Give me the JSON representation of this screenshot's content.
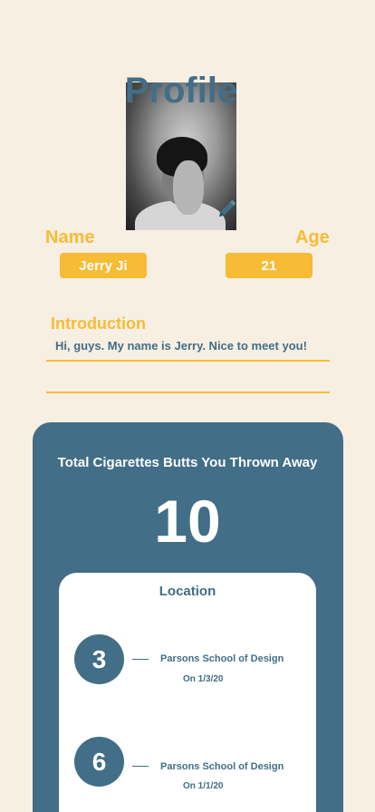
{
  "header": {
    "title": "Profile"
  },
  "profile": {
    "name_label": "Name",
    "age_label": "Age",
    "name_value": "Jerry Ji",
    "age_value": "21",
    "intro_label": "Introduction",
    "intro_text": "Hi, guys. My name is Jerry. Nice to meet you!"
  },
  "stats": {
    "title": "Total Cigarettes Butts You Thrown Away",
    "count": "10"
  },
  "locations": {
    "title": "Location",
    "items": [
      {
        "count": "3",
        "place": "Parsons School of Design",
        "date": "On 1/3/20"
      },
      {
        "count": "6",
        "place": "Parsons School of Design",
        "date": "On 1/1/20"
      }
    ]
  },
  "icons": {
    "edit": "pencil-icon"
  },
  "colors": {
    "background": "#f7efe2",
    "primary": "#426e87",
    "accent": "#f7bc35"
  }
}
